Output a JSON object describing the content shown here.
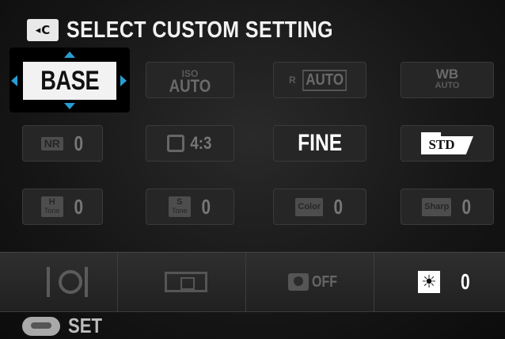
{
  "header": {
    "icon_text": "C",
    "title": "SELECT CUSTOM SETTING"
  },
  "selected_item": {
    "label": "BASE"
  },
  "grid": {
    "row1": {
      "iso": {
        "top": "ISO",
        "bottom": "AUTO"
      },
      "dr": {
        "prefix": "R",
        "value": "AUTO"
      },
      "wb": {
        "top": "WB",
        "bottom": "AUTO"
      }
    },
    "row2": {
      "nr": {
        "label": "NR",
        "value": "0"
      },
      "size": {
        "value": "4:3"
      },
      "quality": {
        "value": "FINE"
      },
      "film": {
        "value": "STD"
      }
    },
    "row3": {
      "highlight_tone": {
        "top": "H",
        "bottom": "Tone",
        "value": "0"
      },
      "shadow_tone": {
        "top": "S",
        "bottom": "Tone",
        "value": "0"
      },
      "color": {
        "label": "Color",
        "value": "0"
      },
      "sharp": {
        "label": "Sharp",
        "value": "0"
      }
    }
  },
  "bottom_bar": {
    "face_detect": {
      "value": "OFF"
    },
    "brightness": {
      "value": "0"
    }
  },
  "footer": {
    "label": "SET"
  }
}
